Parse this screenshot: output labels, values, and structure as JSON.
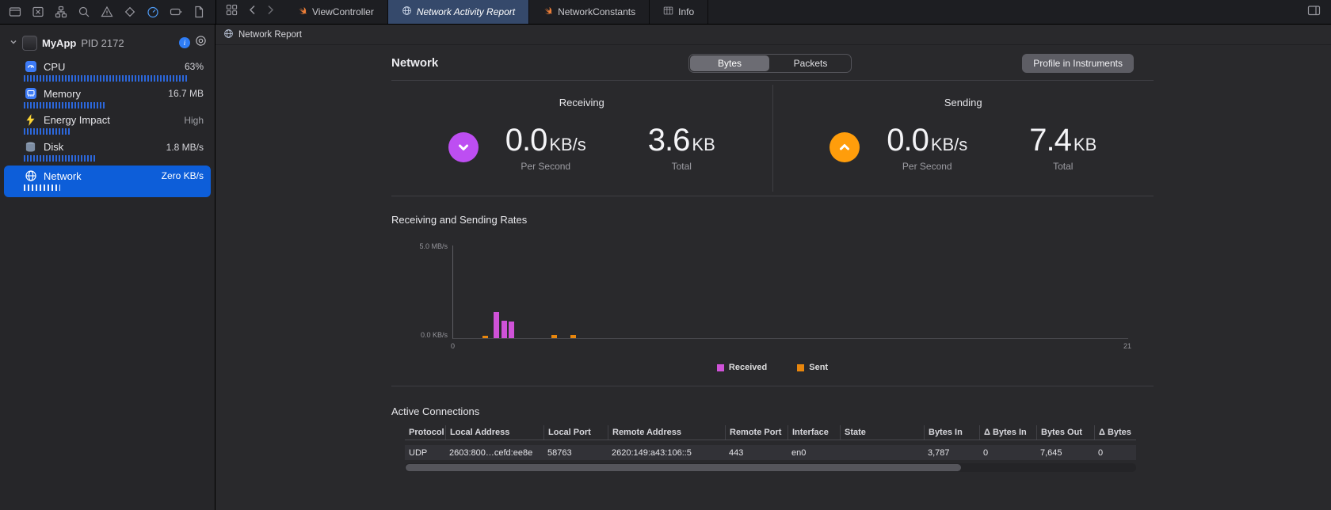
{
  "topbar": {
    "tabs": [
      {
        "label": "ViewController"
      },
      {
        "label": "Network Activity Report"
      },
      {
        "label": "NetworkConstants"
      },
      {
        "label": "Info"
      }
    ]
  },
  "jumpbar": {
    "label": "Network Report"
  },
  "sidebar": {
    "process": {
      "name": "MyApp",
      "pid": "PID 2172"
    },
    "items": [
      {
        "label": "CPU",
        "value": "63%"
      },
      {
        "label": "Memory",
        "value": "16.7 MB"
      },
      {
        "label": "Energy Impact",
        "value": "High"
      },
      {
        "label": "Disk",
        "value": "1.8 MB/s"
      },
      {
        "label": "Network",
        "value": "Zero KB/s",
        "selected": true
      }
    ]
  },
  "report": {
    "title": "Network",
    "segments": [
      {
        "label": "Bytes",
        "selected": true
      },
      {
        "label": "Packets",
        "selected": false
      }
    ],
    "profile_button": "Profile in Instruments",
    "receiving": {
      "title": "Receiving",
      "rate_value": "0.0",
      "rate_unit": "KB/s",
      "rate_caption": "Per Second",
      "total_value": "3.6",
      "total_unit": "KB",
      "total_caption": "Total"
    },
    "sending": {
      "title": "Sending",
      "rate_value": "0.0",
      "rate_unit": "KB/s",
      "rate_caption": "Per Second",
      "total_value": "7.4",
      "total_unit": "KB",
      "total_caption": "Total"
    },
    "rates_title": "Receiving and Sending Rates",
    "connections_title": "Active Connections"
  },
  "chart_data": {
    "type": "bar",
    "title": "Receiving and Sending Rates",
    "xlabel": "",
    "ylabel": "",
    "x_range": [
      0,
      21
    ],
    "y_range_mb_per_s": [
      0,
      5
    ],
    "y_axis_labels": {
      "top": "5.0 MB/s",
      "bottom": "0.0 KB/s"
    },
    "x_axis_labels": {
      "start": "0",
      "end": "21"
    },
    "grid": false,
    "legend_position": "bottom",
    "series": [
      {
        "name": "Received",
        "color": "#cf52d8",
        "points": [
          {
            "x": 1.25,
            "y": 1.4
          },
          {
            "x": 1.5,
            "y": 0.95
          },
          {
            "x": 1.72,
            "y": 0.9
          }
        ]
      },
      {
        "name": "Sent",
        "color": "#e8860d",
        "points": [
          {
            "x": 0.92,
            "y": 0.15
          },
          {
            "x": 3.05,
            "y": 0.18
          },
          {
            "x": 3.65,
            "y": 0.18
          }
        ]
      }
    ]
  },
  "connections": {
    "columns": [
      "Protocol",
      "Local Address",
      "Local Port",
      "Remote Address",
      "Remote Port",
      "Interface",
      "State",
      "Bytes In",
      "Δ Bytes In",
      "Bytes Out",
      "Δ Bytes"
    ],
    "rows": [
      [
        "UDP",
        "2603:800…cefd:ee8e",
        "58763",
        "2620:149:a43:106::5",
        "443",
        "en0",
        "",
        "3,787",
        "0",
        "7,645",
        "0"
      ]
    ]
  }
}
